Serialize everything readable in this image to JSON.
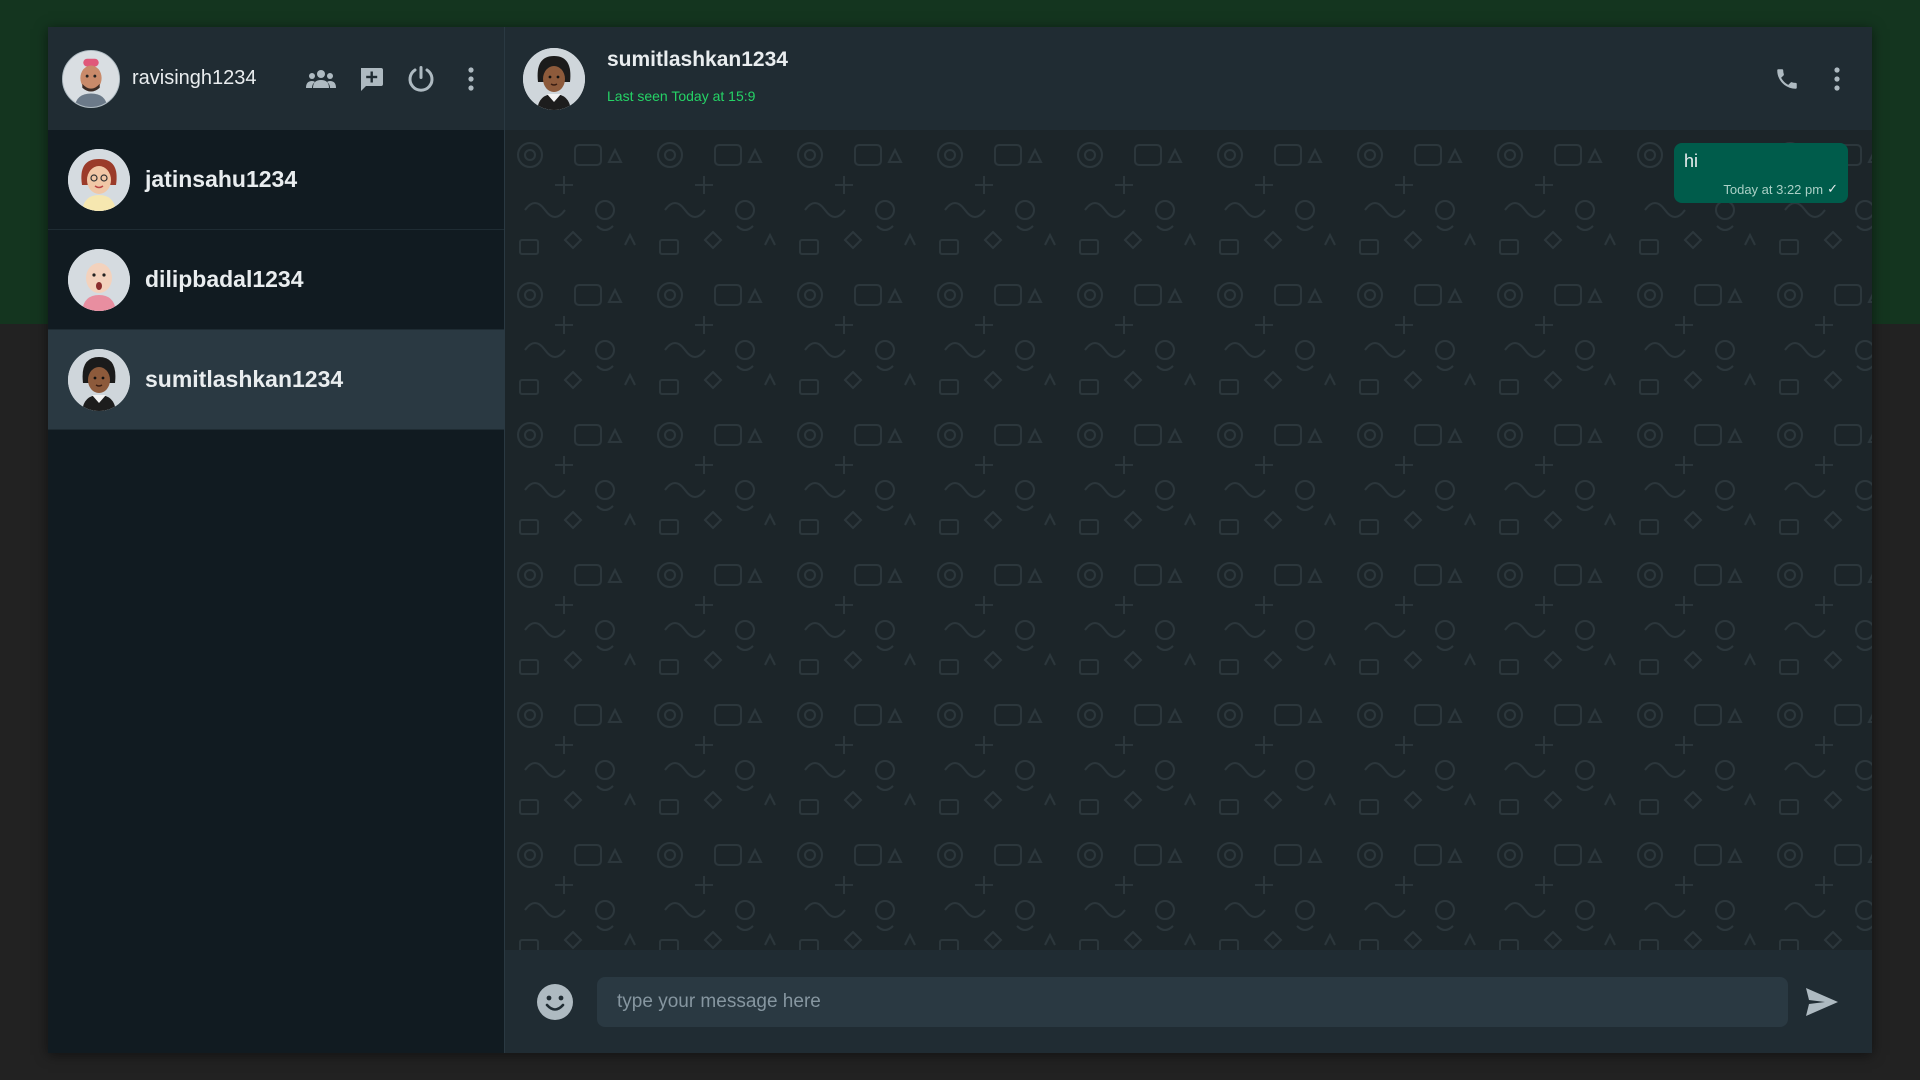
{
  "colors": {
    "accent_green": "#25d366",
    "outgoing_bubble": "#005c4b",
    "panel": "#202c33",
    "background": "#111b21"
  },
  "sidebar": {
    "user": {
      "name": "ravisingh1234",
      "avatar_icon": "avatar-ravi"
    },
    "header_icons": [
      "people-icon",
      "new-chat-icon",
      "power-icon",
      "more-vert-icon"
    ],
    "chats": [
      {
        "name": "jatinsahu1234",
        "avatar_icon": "avatar-jatin",
        "active": false
      },
      {
        "name": "dilipbadal1234",
        "avatar_icon": "avatar-dilip",
        "active": false
      },
      {
        "name": "sumitlashkan1234",
        "avatar_icon": "avatar-sumit",
        "active": true
      }
    ]
  },
  "conversation": {
    "contact_name": "sumitlashkan1234",
    "status": "Last seen Today at 15:9",
    "header_icons": [
      "phone-icon",
      "more-vert-icon"
    ],
    "messages": [
      {
        "text": "hi",
        "time": "Today at 3:22 pm",
        "tick": "✓",
        "outgoing": true
      }
    ]
  },
  "composer": {
    "placeholder": "type your message here",
    "value": ""
  }
}
